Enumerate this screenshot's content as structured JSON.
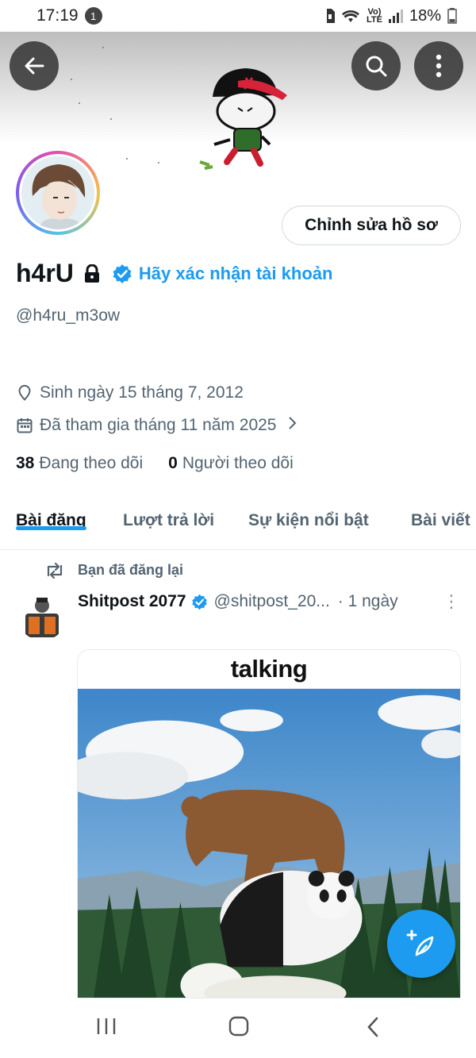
{
  "status_bar": {
    "time": "17:19",
    "notification_count": "1",
    "volte_top": "Vo)",
    "volte_bottom": "LTE",
    "battery": "18%"
  },
  "profile": {
    "display_name": "h4rU",
    "verify_prompt": "Hãy xác nhận tài khoản",
    "handle": "@h4ru_m3ow",
    "edit_button": "Chỉnh sửa hồ sơ",
    "birthday": "Sinh ngày 15 tháng 7, 2012",
    "joined": "Đã tham gia tháng 11 năm 2025",
    "following_count": "38",
    "following_label": "Đang theo dõi",
    "followers_count": "0",
    "followers_label": "Người theo dõi"
  },
  "tabs": [
    {
      "label": "Bài đăng",
      "active": true
    },
    {
      "label": "Lượt trả lời",
      "active": false
    },
    {
      "label": "Sự kiện nổi bật",
      "active": false
    },
    {
      "label": "Bài viết",
      "active": false
    }
  ],
  "post": {
    "repost_label": "Bạn đã đăng lại",
    "author": "Shitpost 2077",
    "handle": "@shitpost_20...",
    "time": "· 1 ngày",
    "more": "⋮",
    "media_caption": "talking"
  },
  "colors": {
    "accent": "#1d9bf0",
    "text_primary": "#0f1419",
    "text_secondary": "#536471"
  },
  "icons": {
    "back": "arrow-left-icon",
    "search": "search-icon",
    "more": "more-vertical-icon",
    "lock": "lock-icon",
    "verified": "verified-badge-icon",
    "location": "location-pin-icon",
    "calendar": "calendar-icon",
    "repost": "repost-icon",
    "compose": "compose-feather-icon"
  }
}
